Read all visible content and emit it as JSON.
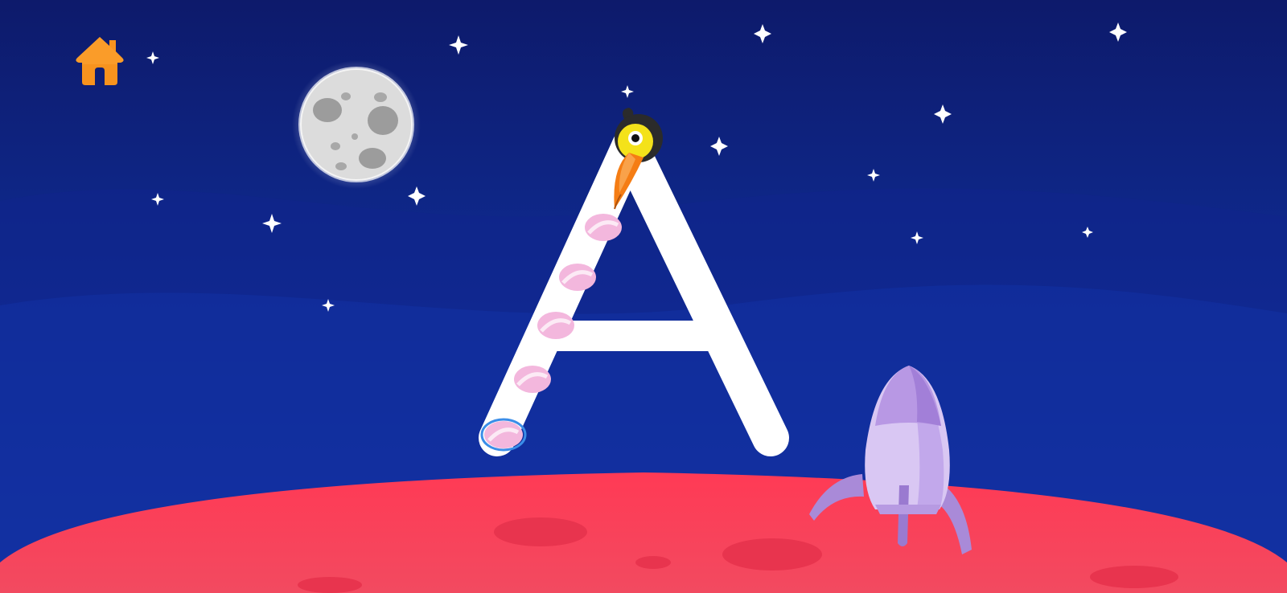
{
  "app": {
    "screen": "letter-tracing"
  },
  "toolbar": {
    "home_icon": "home-icon",
    "home_color": "#f7931e"
  },
  "tracing": {
    "letter": "A",
    "current_stroke": 1,
    "total_strokes": 3,
    "guide_character_icon": "toucan-icon",
    "guide_color": "#e8a6d2",
    "start_marker_color": "#3b8ee8"
  },
  "scene": {
    "background": "night-sky",
    "sky_colors": [
      "#0d1a6b",
      "#1740b8"
    ],
    "ground_color": "#f03a55",
    "moon_icon": "moon-icon",
    "rocket_icon": "rocket-icon",
    "star_icon": "star-icon"
  }
}
